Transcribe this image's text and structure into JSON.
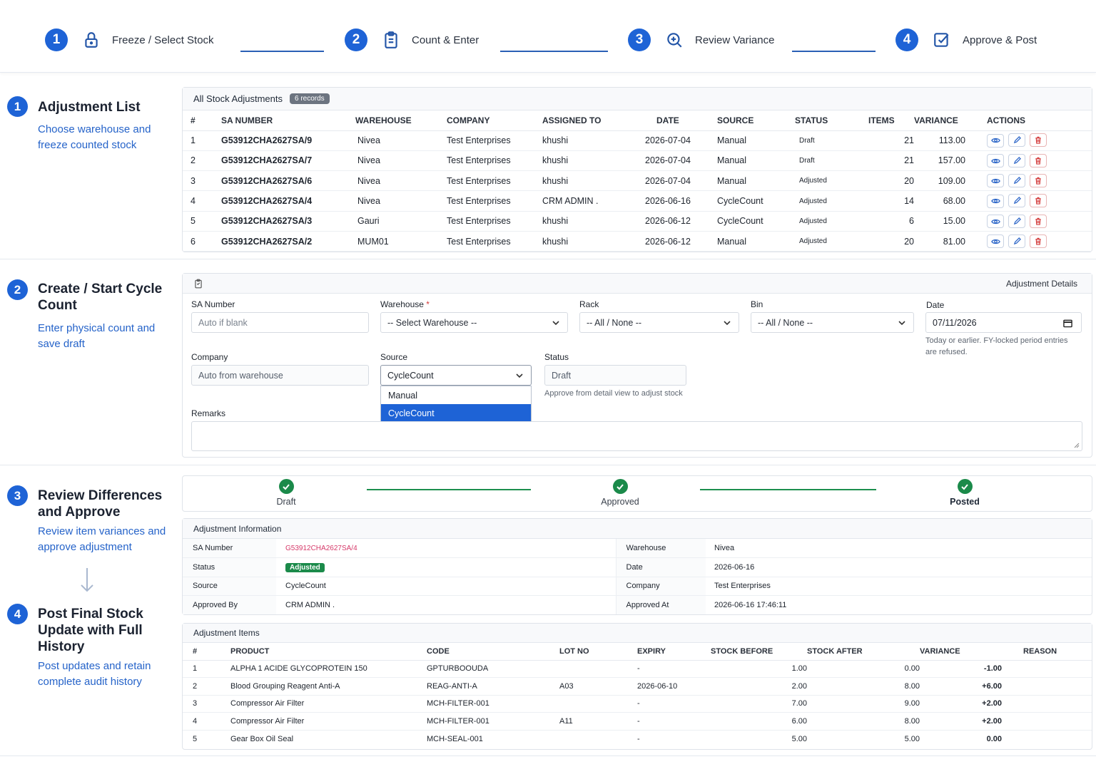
{
  "stepper": [
    {
      "num": "1",
      "label": "Freeze / Select Stock",
      "icon": "lock-icon"
    },
    {
      "num": "2",
      "label": "Count & Enter",
      "icon": "clipboard-icon"
    },
    {
      "num": "3",
      "label": "Review Variance",
      "icon": "magnify-icon"
    },
    {
      "num": "4",
      "label": "Approve & Post",
      "icon": "checkbox-icon"
    }
  ],
  "left": [
    {
      "num": "1",
      "title": "Adjustment List",
      "sub": "Choose warehouse and freeze counted stock"
    },
    {
      "num": "2",
      "title": "Create / Start Cycle Count",
      "sub": "Enter physical count and save draft"
    },
    {
      "num": "3",
      "title": "Review Differences and Approve",
      "sub": "Review item variances and approve adjustment"
    },
    {
      "num": "4",
      "title": "Post Final Stock Update with Full History",
      "sub": "Post updates and retain complete audit history"
    }
  ],
  "list": {
    "title": "All Stock Adjustments",
    "badge": "6 records",
    "headers": [
      "#",
      "SA NUMBER",
      "WAREHOUSE",
      "COMPANY",
      "ASSIGNED TO",
      "DATE",
      "SOURCE",
      "STATUS",
      "ITEMS",
      "VARIANCE",
      "ACTIONS"
    ],
    "rows": [
      {
        "n": "1",
        "sa": "G53912CHA2627SA/9",
        "wh": "Nivea",
        "co": "Test Enterprises",
        "as": "khushi",
        "date": "2026-07-04",
        "src": "Manual",
        "st": "Draft",
        "items": "21",
        "var": "113.00"
      },
      {
        "n": "2",
        "sa": "G53912CHA2627SA/7",
        "wh": "Nivea",
        "co": "Test Enterprises",
        "as": "khushi",
        "date": "2026-07-04",
        "src": "Manual",
        "st": "Draft",
        "items": "21",
        "var": "157.00"
      },
      {
        "n": "3",
        "sa": "G53912CHA2627SA/6",
        "wh": "Nivea",
        "co": "Test Enterprises",
        "as": "khushi",
        "date": "2026-07-04",
        "src": "Manual",
        "st": "Adjusted",
        "items": "20",
        "var": "109.00"
      },
      {
        "n": "4",
        "sa": "G53912CHA2627SA/4",
        "wh": "Nivea",
        "co": "Test Enterprises",
        "as": "CRM ADMIN .",
        "date": "2026-06-16",
        "src": "CycleCount",
        "st": "Adjusted",
        "items": "14",
        "var": "68.00"
      },
      {
        "n": "5",
        "sa": "G53912CHA2627SA/3",
        "wh": "Gauri",
        "co": "Test Enterprises",
        "as": "khushi",
        "date": "2026-06-12",
        "src": "CycleCount",
        "st": "Adjusted",
        "items": "6",
        "var": "15.00"
      },
      {
        "n": "6",
        "sa": "G53912CHA2627SA/2",
        "wh": "MUM01",
        "co": "Test Enterprises",
        "as": "khushi",
        "date": "2026-06-12",
        "src": "Manual",
        "st": "Adjusted",
        "items": "20",
        "var": "81.00"
      }
    ]
  },
  "form": {
    "header_right": "Adjustment Details",
    "sa_label": "SA Number",
    "sa_placeholder": "Auto if blank",
    "wh_label": "Warehouse",
    "wh_required": "*",
    "wh_value": "-- Select Warehouse --",
    "rack_label": "Rack",
    "rack_value": "-- All / None --",
    "bin_label": "Bin",
    "bin_value": "-- All / None --",
    "date_label": "Date",
    "date_value": "07/11/2026",
    "date_help": "Today or earlier. FY-locked period entries are refused.",
    "company_label": "Company",
    "company_value": "Auto from warehouse",
    "source_label": "Source",
    "source_value": "CycleCount",
    "source_options": [
      "Manual",
      "CycleCount"
    ],
    "status_label": "Status",
    "status_value": "Draft",
    "status_help": "Approve from detail view to adjust stock",
    "remarks_label": "Remarks"
  },
  "progress": [
    "Draft",
    "Approved",
    "Posted"
  ],
  "info": {
    "title": "Adjustment Information",
    "rows": [
      {
        "k1": "SA Number",
        "v1": "G53912CHA2627SA/4",
        "k2": "Warehouse",
        "v2": "Nivea"
      },
      {
        "k1": "Status",
        "v1": "Adjusted",
        "k2": "Date",
        "v2": "2026-06-16"
      },
      {
        "k1": "Source",
        "v1": "CycleCount",
        "k2": "Company",
        "v2": "Test Enterprises"
      },
      {
        "k1": "Approved By",
        "v1": "CRM ADMIN .",
        "k2": "Approved At",
        "v2": "2026-06-16 17:46:11"
      }
    ]
  },
  "items": {
    "title": "Adjustment Items",
    "headers": [
      "#",
      "PRODUCT",
      "CODE",
      "LOT NO",
      "EXPIRY",
      "STOCK BEFORE",
      "STOCK AFTER",
      "VARIANCE",
      "REASON"
    ],
    "rows": [
      {
        "n": "1",
        "p": "ALPHA 1 ACIDE GLYCOPROTEIN 150",
        "c": "GPTURBOOUDA",
        "lot": "",
        "exp": "-",
        "before": "1.00",
        "after": "0.00",
        "var": "-1.00",
        "sign": "neg"
      },
      {
        "n": "2",
        "p": "Blood Grouping Reagent Anti-A",
        "c": "REAG-ANTI-A",
        "lot": "A03",
        "exp": "2026-06-10",
        "before": "2.00",
        "after": "8.00",
        "var": "+6.00",
        "sign": "pos"
      },
      {
        "n": "3",
        "p": "Compressor Air Filter",
        "c": "MCH-FILTER-001",
        "lot": "",
        "exp": "-",
        "before": "7.00",
        "after": "9.00",
        "var": "+2.00",
        "sign": "pos"
      },
      {
        "n": "4",
        "p": "Compressor Air Filter",
        "c": "MCH-FILTER-001",
        "lot": "A11",
        "exp": "-",
        "before": "6.00",
        "after": "8.00",
        "var": "+2.00",
        "sign": "pos"
      },
      {
        "n": "5",
        "p": "Gear Box Oil Seal",
        "c": "MCH-SEAL-001",
        "lot": "",
        "exp": "-",
        "before": "5.00",
        "after": "5.00",
        "var": "0.00",
        "sign": "zero"
      }
    ]
  },
  "colors": {
    "accent": "#1e63d6",
    "success": "#1b8a4a",
    "danger": "#d32f2f",
    "sa_link": "#d63a6a"
  }
}
